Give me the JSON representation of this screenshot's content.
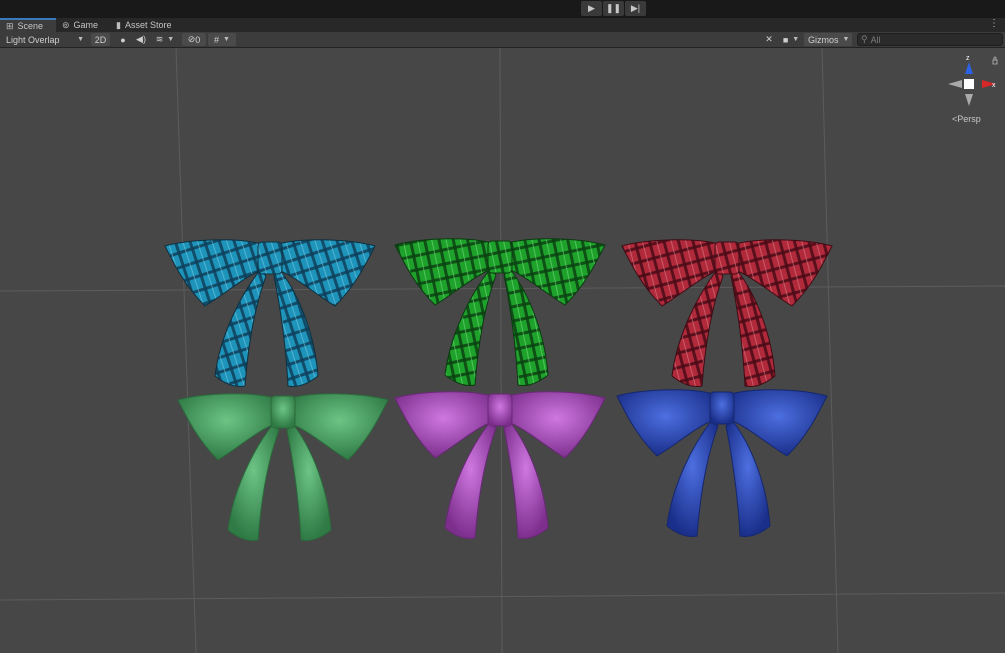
{
  "playbar": {
    "play_icon": "play-icon",
    "pause_icon": "pause-icon",
    "step_icon": "step-icon"
  },
  "tabs": [
    {
      "label": "Scene",
      "icon": "grid-icon",
      "active": true
    },
    {
      "label": "Game",
      "icon": "gamepad-icon",
      "active": false
    },
    {
      "label": "Asset Store",
      "icon": "bag-icon",
      "active": false
    }
  ],
  "toolbar": {
    "draw_mode": "Light Overlap",
    "mode_2d": "2D",
    "hidden_count": "0",
    "gizmos_label": "Gizmos",
    "search_placeholder": "All"
  },
  "gizmo": {
    "x_label": "x",
    "z_label": "z",
    "projection": "Persp",
    "colors": {
      "x": "#d62828",
      "y": "#9aa0a6",
      "z": "#2b62e6"
    }
  },
  "scene": {
    "objects": [
      {
        "name": "blue-plaid-bow",
        "color": "#1e8fb4"
      },
      {
        "name": "green-plaid-bow",
        "color": "#1e9e2a"
      },
      {
        "name": "red-plaid-bow",
        "color": "#b0283a"
      },
      {
        "name": "green-bow",
        "color": "#4fa869"
      },
      {
        "name": "purple-bow",
        "color": "#b051c4"
      },
      {
        "name": "blue-bow",
        "color": "#2f4fc4"
      }
    ]
  }
}
